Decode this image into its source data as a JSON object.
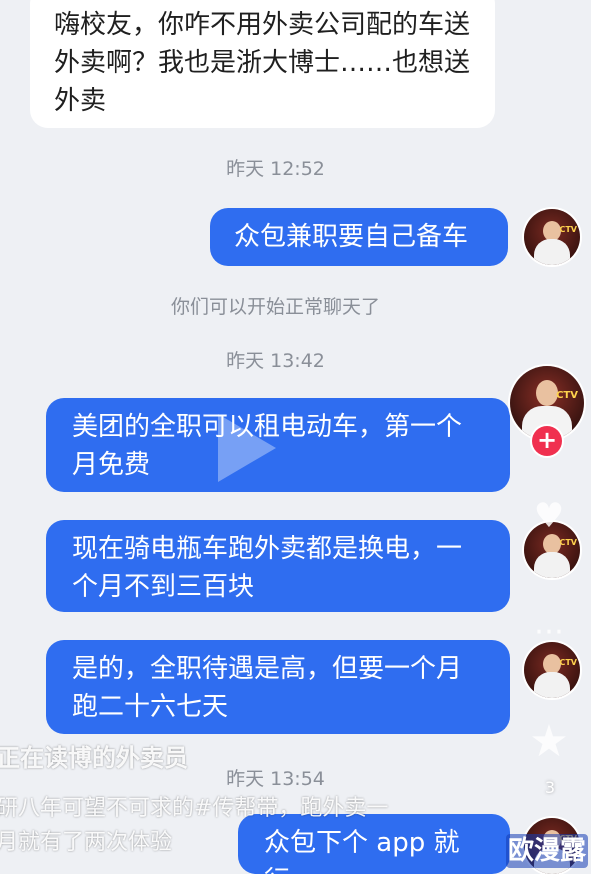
{
  "messages": {
    "incoming_1": "嗨校友，你咋不用外卖公司配的车送外卖啊？我也是浙大博士……也想送外卖",
    "timestamp_1": "昨天 12:52",
    "outgoing_1": "众包兼职要自己备车",
    "system_note": "你们可以开始正常聊天了",
    "timestamp_2": "昨天 13:42",
    "outgoing_2": "美团的全职可以租电动车，第一个月免费",
    "outgoing_3": "现在骑电瓶车跑外卖都是换电，一个月不到三百块",
    "outgoing_4": "是的，全职待遇是高，但要一个月跑二十六七天",
    "timestamp_3": "昨天 13:54",
    "outgoing_5": "众包下个 app 就行"
  },
  "video_overlay": {
    "title": "正在读博的外卖员",
    "caption_line_1": "研八年可望不可求的#传帮带，跑外卖一",
    "caption_line_2": "月就有了两次体验",
    "like_count": "3",
    "watermark": "欧漫露"
  },
  "colors": {
    "outgoing_bubble": "#2f6df0",
    "incoming_bubble": "#ffffff",
    "follow_plus": "#f0304f"
  }
}
